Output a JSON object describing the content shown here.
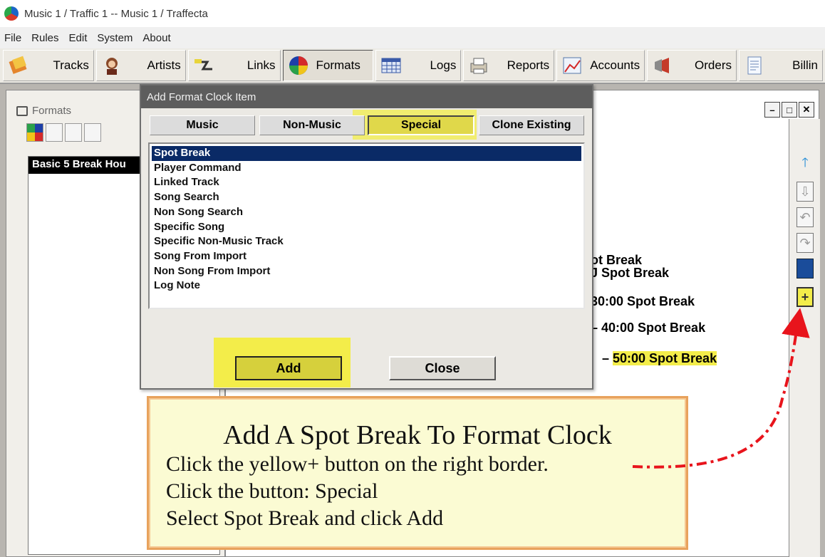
{
  "window": {
    "title": "Music 1 / Traffic 1 -- Music 1 / Traffecta"
  },
  "menu": [
    "File",
    "Rules",
    "Edit",
    "System",
    "About"
  ],
  "toolbar": [
    {
      "label": "Tracks",
      "icon": "tracks-icon"
    },
    {
      "label": "Artists",
      "icon": "artists-icon"
    },
    {
      "label": "Links",
      "icon": "links-icon"
    },
    {
      "label": "Formats",
      "icon": "formats-icon",
      "active": true
    },
    {
      "label": "Logs",
      "icon": "logs-icon"
    },
    {
      "label": "Reports",
      "icon": "reports-icon"
    },
    {
      "label": "Accounts",
      "icon": "accounts-icon"
    },
    {
      "label": "Orders",
      "icon": "orders-icon"
    },
    {
      "label": "Billin",
      "icon": "billing-icon"
    }
  ],
  "left_panel": {
    "title": "Formats",
    "selected_item": "Basic 5 Break Hou"
  },
  "clock_entries": [
    "ot Break",
    "J Spot Break",
    "30:00 Spot Break",
    "40:00 Spot Break",
    "50:00 Spot Break"
  ],
  "dialog": {
    "title": "Add Format Clock Item",
    "tabs": [
      "Music",
      "Non-Music",
      "Special",
      "Clone Existing"
    ],
    "active_tab": "Special",
    "items": [
      "Spot Break",
      "Player Command",
      "Linked Track",
      "Song Search",
      "Non Song Search",
      "Specific Song",
      "Specific Non-Music Track",
      "Song From Import",
      "Non Song From Import",
      "Log Note"
    ],
    "selected_item": "Spot Break",
    "add_label": "Add",
    "close_label": "Close"
  },
  "callout": {
    "title": "Add A Spot Break To Format Clock",
    "lines": [
      "Click the yellow+ button on the right border.",
      "Click the button:  Special",
      "Select Spot Break and click Add"
    ]
  },
  "colors": {
    "highlight": "#f3ed4a",
    "selection": "#0a2a66",
    "arrow": "#e8141c",
    "callout_border": "#e8a25c"
  }
}
